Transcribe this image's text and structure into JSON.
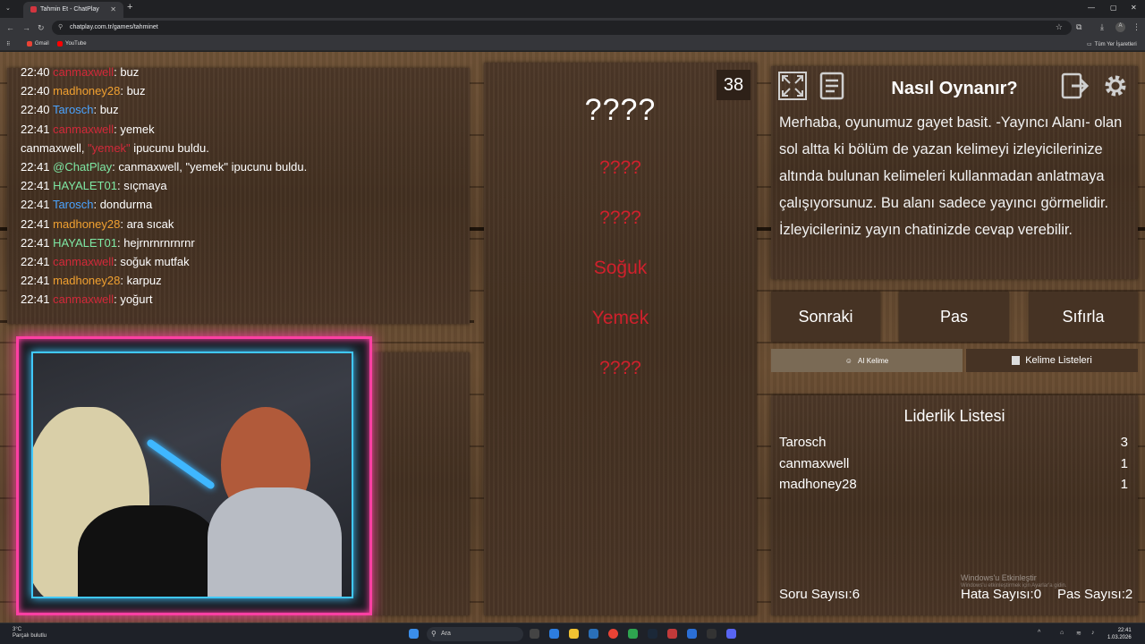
{
  "browser": {
    "tab_title": "Tahmin Et - ChatPlay",
    "url": "chatplay.com.tr/games/tahminet",
    "bookmarks": [
      "Gmail",
      "YouTube"
    ],
    "all_bookmarks": "Tüm Yer İşaretleri"
  },
  "chat": {
    "messages": [
      {
        "time": "22:40",
        "user": "canmaxwell",
        "color": "#d2293a",
        "text": "buz"
      },
      {
        "time": "22:40",
        "user": "madhoney28",
        "color": "#f0a030",
        "text": "buz"
      },
      {
        "time": "22:40",
        "user": "Tarosch",
        "color": "#4aa3ff",
        "text": "buz"
      },
      {
        "time": "22:41",
        "user": "canmaxwell",
        "color": "#d2293a",
        "text": "yemek"
      },
      {
        "time": "",
        "user": "",
        "color": "#4aa3ff",
        "text": ""
      },
      {
        "time": "22:41",
        "user": "@ChatPlay",
        "color": "#7ee8a4",
        "text": "canmaxwell, \"yemek\" ipucunu buldu."
      },
      {
        "time": "22:41",
        "user": "HAYALET01",
        "color": "#7ee8a4",
        "text": "sıçmaya"
      },
      {
        "time": "22:41",
        "user": "Tarosch",
        "color": "#4aa3ff",
        "text": "dondurma"
      },
      {
        "time": "22:41",
        "user": "madhoney28",
        "color": "#f0a030",
        "text": "ara sıcak"
      },
      {
        "time": "22:41",
        "user": "HAYALET01",
        "color": "#7ee8a4",
        "text": "hejrnrnrnrnrnr"
      },
      {
        "time": "22:41",
        "user": "canmaxwell",
        "color": "#d2293a",
        "text": "soğuk mutfak"
      },
      {
        "time": "22:41",
        "user": "madhoney28",
        "color": "#f0a030",
        "text": "karpuz"
      },
      {
        "time": "22:41",
        "user": "canmaxwell",
        "color": "#d2293a",
        "text": "yoğurt"
      }
    ],
    "system_line": {
      "part1": "canmaxwell, ",
      "part2": "\"yemek\"",
      "part3": " ipucunu buldu."
    }
  },
  "game": {
    "main_word": "????",
    "timer": "38",
    "hints": [
      "????",
      "????",
      "Soğuk",
      "Yemek",
      "????"
    ]
  },
  "rules": {
    "title": "Nasıl Oynanır?",
    "text": "Merhaba, oyunumuz gayet basit. -Yayıncı Alanı- olan sol altta ki bölüm de yazan kelimeyi izleyicilerinize altında bulunan kelimeleri kullanmadan anlatmaya çalışıyorsunuz. Bu alanı sadece yayıncı görmelidir. İzleyicileriniz yayın chatinizde cevap verebilir."
  },
  "buttons": {
    "next": "Sonraki",
    "pass": "Pas",
    "reset": "Sıfırla",
    "ai_word": "AI Kelime",
    "word_lists": "Kelime Listeleri"
  },
  "leaderboard": {
    "title": "Liderlik Listesi",
    "rows": [
      {
        "name": "Tarosch",
        "score": "3"
      },
      {
        "name": "canmaxwell",
        "score": "1"
      },
      {
        "name": "madhoney28",
        "score": "1"
      }
    ]
  },
  "stats": {
    "questions": "Soru Sayısı:6",
    "errors": "Hata Sayısı:0",
    "passes": "Pas Sayısı:2"
  },
  "watermark": {
    "line1": "Windows'u Etkinleştir",
    "line2": "Windows'u etkinleştirmek için Ayarlar'a gidin."
  },
  "taskbar": {
    "weather_temp": "3°C",
    "weather_desc": "Parçalı bulutlu",
    "search_placeholder": "Ara",
    "time": "22:41",
    "date": "1.03.2026"
  },
  "colors": {
    "hint_red": "#d0202c",
    "cam_pink": "#ff3fa3",
    "cam_cyan": "#40c8ff"
  }
}
